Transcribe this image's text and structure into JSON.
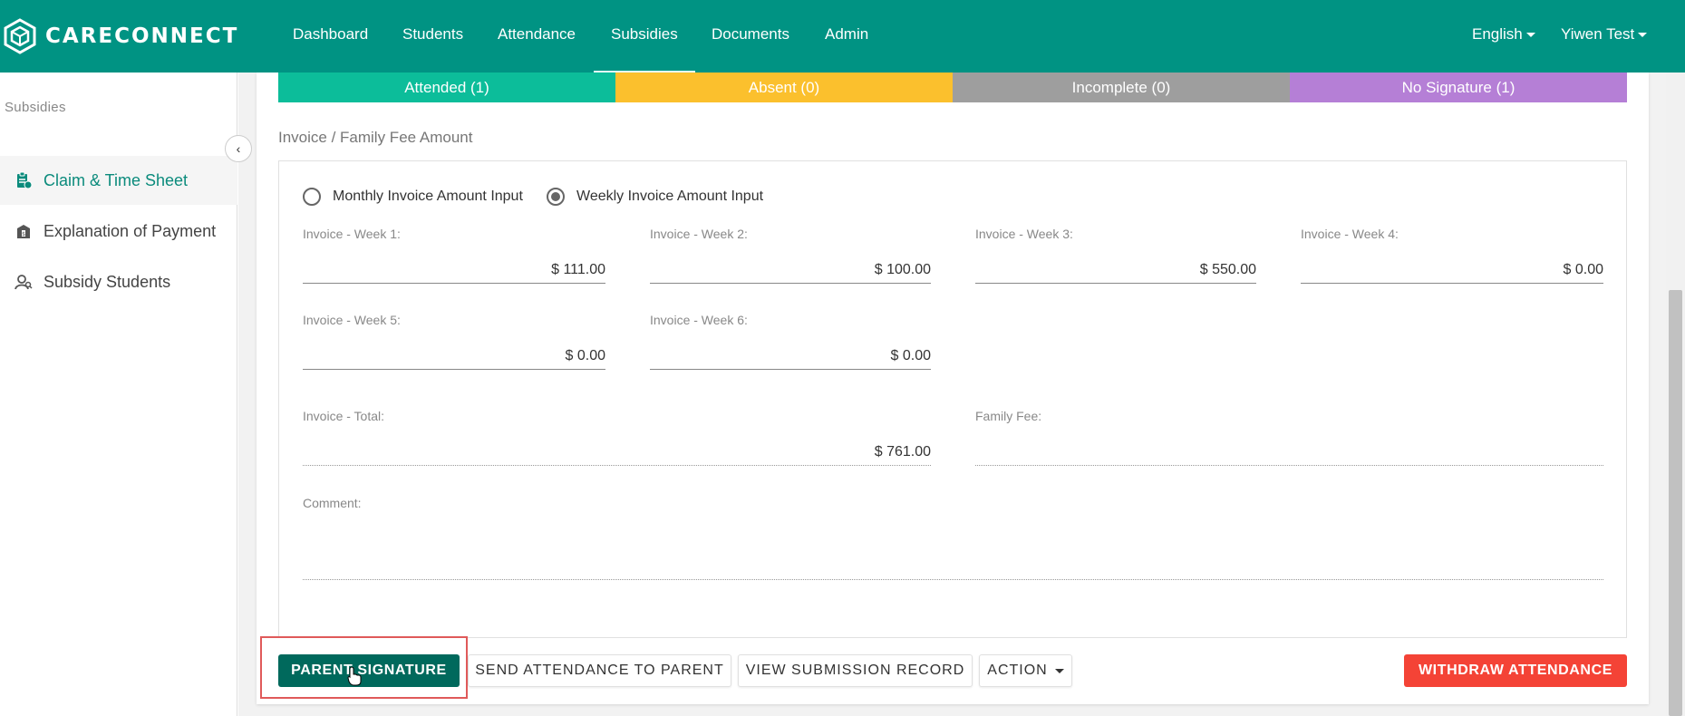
{
  "brand": {
    "name": "CARECONNECT",
    "color": "#009383"
  },
  "nav": {
    "items": [
      {
        "label": "Dashboard"
      },
      {
        "label": "Students"
      },
      {
        "label": "Attendance"
      },
      {
        "label": "Subsidies",
        "active": true
      },
      {
        "label": "Documents"
      },
      {
        "label": "Admin"
      }
    ],
    "language": "English",
    "user": "Yiwen Test"
  },
  "sidebar": {
    "section": "Subsidies",
    "items": [
      {
        "label": "Claim & Time Sheet",
        "icon": "clipboard-icon",
        "active": true
      },
      {
        "label": "Explanation of Payment",
        "icon": "storefront-icon"
      },
      {
        "label": "Subsidy Students",
        "icon": "user-search-icon"
      }
    ]
  },
  "status_bar": [
    {
      "label": "Attended (1)",
      "color": "#0cbd9a"
    },
    {
      "label": "Absent (0)",
      "color": "#fbc02d"
    },
    {
      "label": "Incomplete (0)",
      "color": "#9e9e9e"
    },
    {
      "label": "No Signature (1)",
      "color": "#b57fd6"
    }
  ],
  "invoice": {
    "title": "Invoice / Family Fee Amount",
    "mode_monthly": "Monthly Invoice Amount Input",
    "mode_weekly": "Weekly Invoice Amount Input",
    "selected_mode": "weekly",
    "weeks": [
      {
        "label": "Invoice - Week 1:",
        "value": "$ 111.00"
      },
      {
        "label": "Invoice - Week 2:",
        "value": "$ 100.00"
      },
      {
        "label": "Invoice - Week 3:",
        "value": "$ 550.00"
      },
      {
        "label": "Invoice - Week 4:",
        "value": "$ 0.00"
      },
      {
        "label": "Invoice - Week 5:",
        "value": "$ 0.00"
      },
      {
        "label": "Invoice - Week 6:",
        "value": "$ 0.00"
      }
    ],
    "total_label": "Invoice - Total:",
    "total_value": "$ 761.00",
    "family_fee_label": "Family Fee:",
    "family_fee_value": "",
    "comment_label": "Comment:",
    "comment_value": ""
  },
  "actions": {
    "parent_signature": "PARENT SIGNATURE",
    "send_attendance": "SEND ATTENDANCE TO PARENT",
    "view_submission": "VIEW SUBMISSION RECORD",
    "action": "ACTION",
    "withdraw": "WITHDRAW ATTENDANCE"
  },
  "colors": {
    "primary_dark": "#00695c",
    "danger": "#f44336"
  }
}
